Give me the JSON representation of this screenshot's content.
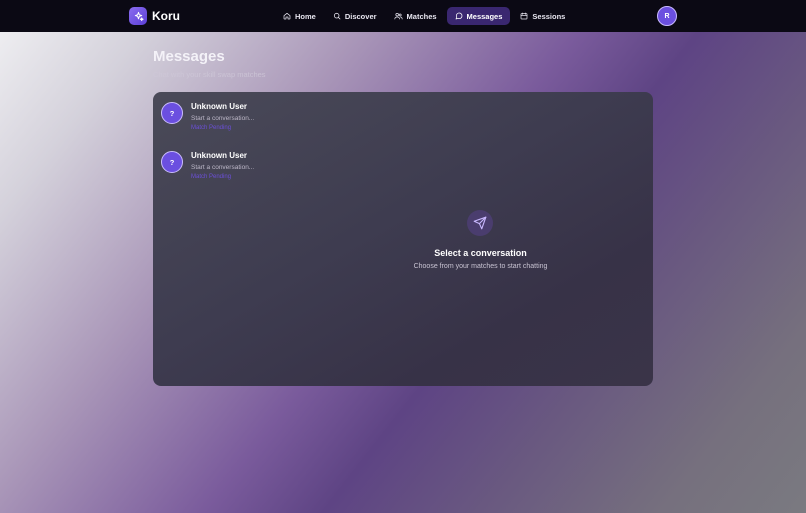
{
  "brand": {
    "name": "Koru",
    "logo_icon": "sparkles-icon"
  },
  "nav": {
    "items": [
      {
        "label": "Home",
        "icon": "home-icon",
        "active": false
      },
      {
        "label": "Discover",
        "icon": "search-icon",
        "active": false
      },
      {
        "label": "Matches",
        "icon": "users-icon",
        "active": false
      },
      {
        "label": "Messages",
        "icon": "message-icon",
        "active": true
      },
      {
        "label": "Sessions",
        "icon": "calendar-icon",
        "active": false
      }
    ]
  },
  "user": {
    "avatar_initial": "R"
  },
  "page": {
    "title": "Messages",
    "subtitle": "Chat with your skill swap matches"
  },
  "conversations": [
    {
      "name": "Unknown User",
      "avatar": "?",
      "preview": "Start a conversation...",
      "status": "Match Pending"
    },
    {
      "name": "Unknown User",
      "avatar": "?",
      "preview": "Start a conversation...",
      "status": "Match Pending"
    }
  ],
  "empty_state": {
    "icon": "send-icon",
    "title": "Select a conversation",
    "subtitle": "Choose from your matches to start chatting"
  },
  "colors": {
    "accent": "#6b4fe0",
    "nav_bg": "#0b0914",
    "active_tab": "#3a2770"
  }
}
